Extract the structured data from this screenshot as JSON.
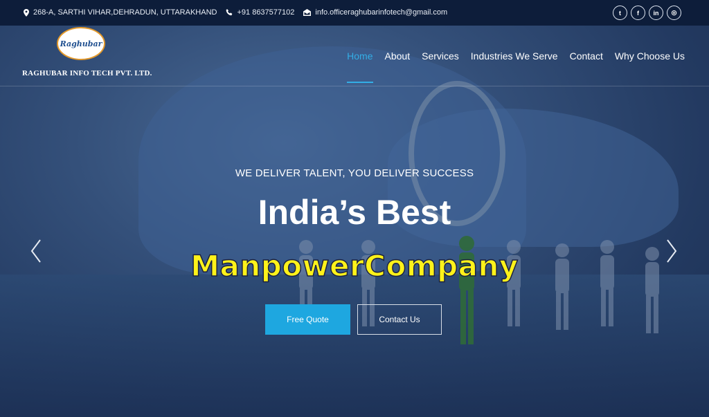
{
  "topbar": {
    "address": "268-A, SARTHI VIHAR,DEHRADUN, UTTARAKHAND",
    "phone": "+91 8637577102",
    "email": "info.officeraghubarinfotech@gmail.com",
    "social": [
      {
        "icon": "twitter-icon",
        "glyph": "t"
      },
      {
        "icon": "facebook-icon",
        "glyph": "f"
      },
      {
        "icon": "linkedin-icon",
        "glyph": "in"
      },
      {
        "icon": "instagram-icon",
        "glyph": "◎"
      }
    ]
  },
  "header": {
    "logo_text": "Raghubar",
    "company_name": "RAGHUBAR INFO TECH PVT. LTD.",
    "nav": [
      {
        "label": "Home",
        "active": true
      },
      {
        "label": "About",
        "active": false
      },
      {
        "label": "Services",
        "active": false
      },
      {
        "label": "Industries We Serve",
        "active": false
      },
      {
        "label": "Contact",
        "active": false
      },
      {
        "label": "Why Choose Us",
        "active": false
      }
    ]
  },
  "hero": {
    "tagline": "WE DELIVER TALENT, YOU DELIVER SUCCESS",
    "headline": "India’s Best",
    "highlight": "ManpowerCompany",
    "primary_button": "Free Quote",
    "secondary_button": "Contact Us"
  },
  "colors": {
    "accent": "#1ea7e0",
    "highlight": "#fff21a",
    "topbar_bg": "#0d1d3a"
  }
}
